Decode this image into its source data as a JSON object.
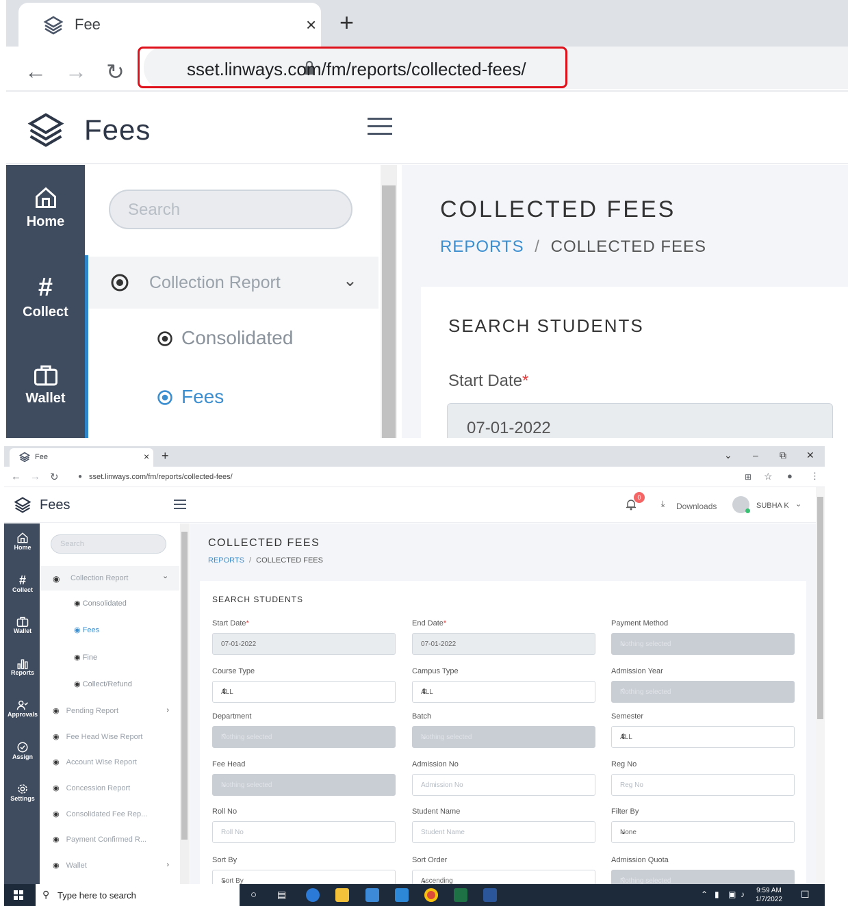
{
  "tab": {
    "title": "Fee",
    "close": "×",
    "new_tab": "+"
  },
  "address": {
    "url_zoom": "sset.linways.com/fm/reports/collected-fees/",
    "url": "sset.linways.com/fm/reports/collected-fees/"
  },
  "app": {
    "name": "Fees"
  },
  "sidebar": {
    "items": [
      {
        "label": "Home",
        "icon": "home-icon"
      },
      {
        "label": "Collect",
        "icon": "hash-icon"
      },
      {
        "label": "Wallet",
        "icon": "wallet-icon"
      },
      {
        "label": "Reports",
        "icon": "bar-chart-icon"
      },
      {
        "label": "Approvals",
        "icon": "user-check-icon"
      },
      {
        "label": "Assign",
        "icon": "check-circle-icon"
      },
      {
        "label": "Settings",
        "icon": "gear-icon"
      }
    ]
  },
  "menu": {
    "search_placeholder": "Search",
    "items": [
      {
        "label": "Collection Report",
        "expander": "⌄"
      },
      {
        "label": "Consolidated"
      },
      {
        "label": "Fees"
      },
      {
        "label": "Fine"
      },
      {
        "label": "Collect/Refund"
      },
      {
        "label": "Pending Report",
        "expander": "›"
      },
      {
        "label": "Fee Head Wise Report"
      },
      {
        "label": "Account Wise Report"
      },
      {
        "label": "Concession Report"
      },
      {
        "label": "Consolidated Fee Rep..."
      },
      {
        "label": "Payment Confirmed R..."
      },
      {
        "label": "Wallet",
        "expander": "›"
      }
    ]
  },
  "page": {
    "title": "COLLECTED FEES",
    "breadcrumb": {
      "parent": "REPORTS",
      "separator": "/",
      "current": "COLLECTED FEES"
    }
  },
  "header": {
    "notification_count": "0",
    "downloads_label": "Downloads",
    "user_name": "SUBHA K"
  },
  "search_card": {
    "title": "SEARCH STUDENTS",
    "fields": {
      "start_date": {
        "label": "Start Date",
        "value": "07-01-2022"
      },
      "end_date": {
        "label": "End Date",
        "value": "07-01-2022"
      },
      "payment_method": {
        "label": "Payment Method",
        "value": "Nothing selected"
      },
      "course_type": {
        "label": "Course Type",
        "value": "ALL"
      },
      "campus_type": {
        "label": "Campus Type",
        "value": "ALL"
      },
      "admission_year": {
        "label": "Admission Year",
        "value": "Nothing selected"
      },
      "department": {
        "label": "Department",
        "value": "Nothing selected"
      },
      "batch": {
        "label": "Batch",
        "value": "Nothing selected"
      },
      "semester": {
        "label": "Semester",
        "value": "ALL"
      },
      "fee_head": {
        "label": "Fee Head",
        "value": "Nothing selected"
      },
      "admission_no": {
        "label": "Admission No",
        "placeholder": "Admission No"
      },
      "reg_no": {
        "label": "Reg No",
        "placeholder": "Reg No"
      },
      "roll_no": {
        "label": "Roll No",
        "placeholder": "Roll No"
      },
      "student_name": {
        "label": "Student Name",
        "placeholder": "Student Name"
      },
      "filter_by": {
        "label": "Filter By",
        "value": "None"
      },
      "sort_by": {
        "label": "Sort By",
        "value": "Sort By"
      },
      "sort_order": {
        "label": "Sort Order",
        "value": "Ascending"
      },
      "admission_quota": {
        "label": "Admission Quota",
        "value": "Nothing selected"
      }
    },
    "required_mark": "*"
  },
  "taskbar": {
    "search_placeholder": "Type here to search",
    "time": "9:59 AM",
    "date": "1/7/2022"
  },
  "colors": {
    "sidebar_bg": "#3f4b5e",
    "accent": "#2d86c9",
    "link": "#3b8ed0",
    "required": "#e53e3e",
    "highlight_box": "#e0101a"
  }
}
